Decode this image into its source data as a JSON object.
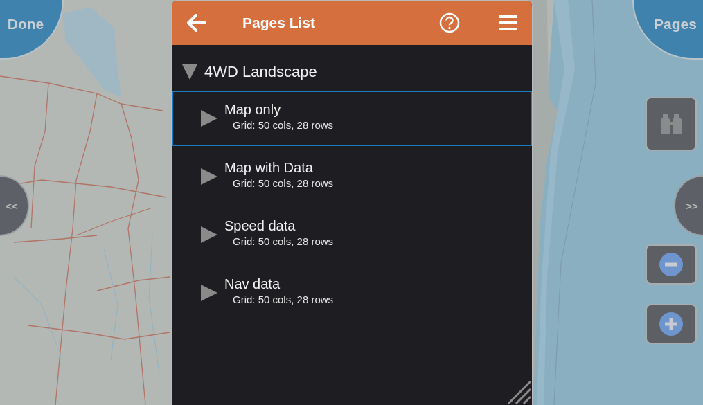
{
  "map_controls": {
    "done": "Done",
    "pages": "Pages",
    "previous": "<<",
    "next": ">>"
  },
  "dialog": {
    "title": "Pages List",
    "tree": [
      {
        "label": "4WD Landscape",
        "expanded": true,
        "children": [
          {
            "label": "Map only",
            "detail": "Grid: 50 cols, 28 rows",
            "selected": true,
            "expanded": false
          },
          {
            "label": "Map with Data",
            "detail": "Grid: 50 cols, 28 rows",
            "selected": false,
            "expanded": false
          },
          {
            "label": "Speed data",
            "detail": "Grid: 50 cols, 28 rows",
            "selected": false,
            "expanded": false
          },
          {
            "label": "Nav data",
            "detail": "Grid: 50 cols, 28 rows",
            "selected": false,
            "expanded": false
          }
        ]
      }
    ]
  }
}
